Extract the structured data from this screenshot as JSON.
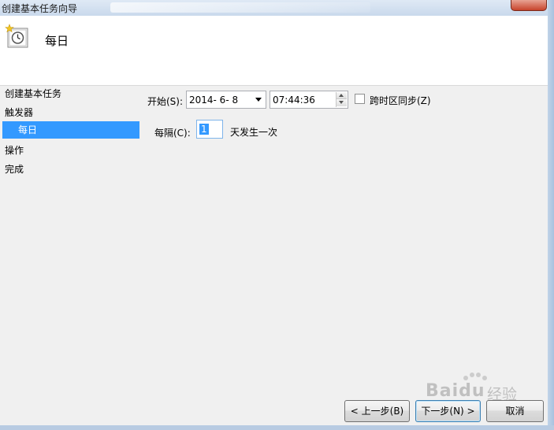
{
  "window": {
    "title": "创建基本任务向导"
  },
  "header": {
    "title": "每日",
    "icon": "task-clock-icon"
  },
  "sidebar": {
    "items": [
      {
        "label": "创建基本任务"
      },
      {
        "label": "触发器"
      },
      {
        "label": "每日",
        "selected": true
      },
      {
        "label": "操作"
      },
      {
        "label": "完成"
      }
    ]
  },
  "form": {
    "start_label": "开始(S):",
    "start_date": "2014- 6- 8",
    "start_time": "07:44:36",
    "sync_label": "跨时区同步(Z)",
    "sync_checked": false,
    "recur_label": "每隔(C):",
    "recur_value": "1",
    "recur_suffix": "天发生一次"
  },
  "buttons": {
    "back": "< 上一步(B)",
    "next": "下一步(N) >",
    "cancel": "取消"
  },
  "watermark": {
    "text": "Baidu",
    "cn": "经验"
  },
  "colors": {
    "selection": "#3399ff",
    "header_bg": "#ffffff",
    "body_bg": "#f0f0f0"
  }
}
